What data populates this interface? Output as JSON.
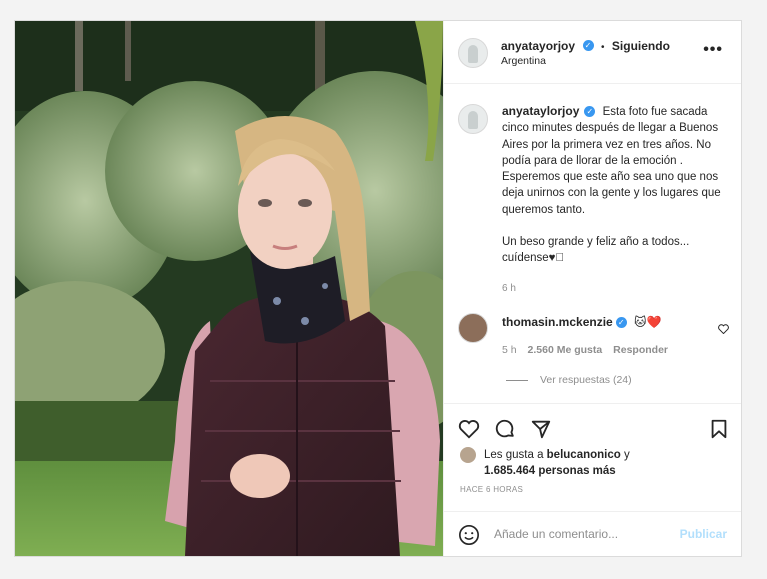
{
  "header": {
    "username": "anyatayorjoy",
    "separator": "•",
    "follow_status": "Siguiendo",
    "location": "Argentina",
    "more_label": "•••"
  },
  "caption": {
    "username": "anyataylorjoy",
    "text": "Esta foto fue sacada cinco minutes después de llegar a Buenos Aires por la primera vez en tres años. No podía para de llorar de la emoción . Esperemos que este año sea uno que nos deja unirnos con la gente y los lugares que queremos tanto.",
    "text2": "Un beso grande y feliz año a todos... cuídense♥🏻",
    "time": "6 h"
  },
  "comment": {
    "username": "thomasin.mckenzie",
    "emojis": "🐱❤️",
    "time": "5 h",
    "likes": "2.560 Me gusta",
    "reply_label": "Responder",
    "view_replies": "Ver respuestas (24)"
  },
  "likes": {
    "line1_prefix": "Les gusta a ",
    "liker": "belucanonico",
    "line1_suffix": " y",
    "line2": "1.685.464 personas más"
  },
  "posted_ago": "HACE 6 HORAS",
  "add_comment": {
    "placeholder": "Añade un comentario...",
    "publish": "Publicar"
  },
  "icons": {
    "heart": "heart-icon",
    "comment": "comment-icon",
    "share": "share-icon",
    "save": "bookmark-icon",
    "emoji": "emoji-icon"
  },
  "colors": {
    "verified": "#3897f0",
    "publish_disabled": "#b2dffc",
    "heart_red": "#ed4956"
  }
}
